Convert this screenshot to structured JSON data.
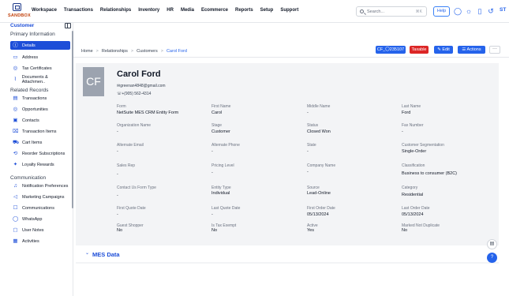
{
  "brand": {
    "logo_text": "SANDBOX"
  },
  "nav": [
    "Workspace",
    "Transactions",
    "Relationships",
    "Inventory",
    "HR",
    "Media",
    "Ecommerce",
    "Reports",
    "Setup",
    "Support"
  ],
  "search": {
    "placeholder": "Search...",
    "shortcut": "⌘K"
  },
  "help_label": "Help",
  "user_initials": "ST",
  "sidebar": {
    "title": "Customer",
    "section_primary": "Primary Information",
    "primary_items": [
      {
        "label": "Details",
        "icon": "info-icon",
        "active": true
      },
      {
        "label": "Address",
        "icon": "address-card-icon"
      },
      {
        "label": "Tax Certificates",
        "icon": "check-circle-icon"
      },
      {
        "label": "Documents & Attachmen..",
        "icon": "paperclip-icon"
      }
    ],
    "section_related": "Related Records",
    "related_items": [
      {
        "label": "Transactions",
        "icon": "table-icon"
      },
      {
        "label": "Opportunities",
        "icon": "target-icon"
      },
      {
        "label": "Contacts",
        "icon": "contact-card-icon"
      },
      {
        "label": "Transaction Items",
        "icon": "receipt-icon"
      },
      {
        "label": "Cart Items",
        "icon": "cart-icon"
      },
      {
        "label": "Reorder Subscriptions",
        "icon": "repeat-icon"
      },
      {
        "label": "Loyalty Rewards",
        "icon": "gift-icon"
      }
    ],
    "section_comm": "Communication",
    "comm_items": [
      {
        "label": "Notification Preferences",
        "icon": "bell-icon"
      },
      {
        "label": "Marketing Campaigns",
        "icon": "megaphone-icon"
      },
      {
        "label": "Communications",
        "icon": "chat-icon"
      },
      {
        "label": "WhatsApp",
        "icon": "whatsapp-icon"
      },
      {
        "label": "User Notes",
        "icon": "note-icon"
      },
      {
        "label": "Activities",
        "icon": "activity-icon"
      }
    ]
  },
  "breadcrumb": [
    "Home",
    "Relationships",
    "Customers",
    "Carol Ford"
  ],
  "header_buttons": {
    "status": "CF_〇235107",
    "taxable": "Taxable",
    "edit": "Edit",
    "actions": "Actions",
    "more": "···"
  },
  "record": {
    "initials": "CF",
    "name": "Carol Ford",
    "email": "greenan4848@gmail.com",
    "phone": "+(905) 562-4314"
  },
  "fields": [
    {
      "label": "Form",
      "value": "NetSuite MES CRM Entity Form"
    },
    {
      "label": "First Name",
      "value": "Carol"
    },
    {
      "label": "Middle Name",
      "value": "-"
    },
    {
      "label": "Last Name",
      "value": "Ford"
    },
    {
      "label": "Organization Name",
      "value": "-"
    },
    {
      "label": "Stage",
      "value": "Customer"
    },
    {
      "label": "Status",
      "value": "Closed Won"
    },
    {
      "label": "Fax Number",
      "value": "-"
    },
    {
      "label": "Alternate Email",
      "value": "-"
    },
    {
      "label": "Alternate Phone",
      "value": "-"
    },
    {
      "label": "State",
      "value": "-"
    },
    {
      "label": "Customer Segmentation",
      "value": "Single-Order"
    },
    {
      "label": "Sales Rep",
      "value": "-"
    },
    {
      "label": "Pricing Level",
      "value": "-"
    },
    {
      "label": "Company Name",
      "value": "-"
    },
    {
      "label": "Classification",
      "value": "Business to consumer (B2C)"
    },
    {
      "label": "Contact Us Form Type",
      "value": "-"
    },
    {
      "label": "Entity Type",
      "value": "Individual"
    },
    {
      "label": "Source",
      "value": "Lead-Online"
    },
    {
      "label": "Category",
      "value": "Residential"
    },
    {
      "label": "First Quote Date",
      "value": "-"
    },
    {
      "label": "Last Quote Date",
      "value": "-"
    },
    {
      "label": "First Order Date",
      "value": "05/13/2024"
    },
    {
      "label": "Last Order Date",
      "value": "05/13/2024"
    },
    {
      "label": "Guest Shopper",
      "value": "No"
    },
    {
      "label": "Is Tax Exempt",
      "value": "No"
    },
    {
      "label": "Active",
      "value": "Yes"
    },
    {
      "label": "Marked Not Duplicate",
      "value": "No"
    }
  ],
  "mes_section": "MES Data"
}
